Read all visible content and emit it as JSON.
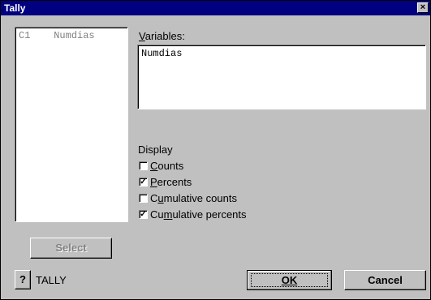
{
  "window": {
    "title": "Tally",
    "close_glyph": "×"
  },
  "columns_list": {
    "items": [
      {
        "col": "C1",
        "name": "Numdias"
      }
    ]
  },
  "variables": {
    "label_underlined": "V",
    "label_rest": "ariables:",
    "value": "Numdias"
  },
  "display": {
    "label": "Display",
    "options": [
      {
        "pre": "",
        "u": "C",
        "post": "ounts",
        "checked": false
      },
      {
        "pre": "",
        "u": "P",
        "post": "ercents",
        "checked": true
      },
      {
        "pre": "C",
        "u": "u",
        "post": "mulative counts",
        "checked": false
      },
      {
        "pre": "Cu",
        "u": "m",
        "post": "ulative percents",
        "checked": true
      }
    ]
  },
  "buttons": {
    "select": "Select",
    "help": "?",
    "ok": "OK",
    "cancel": "Cancel"
  },
  "command_name": "TALLY"
}
